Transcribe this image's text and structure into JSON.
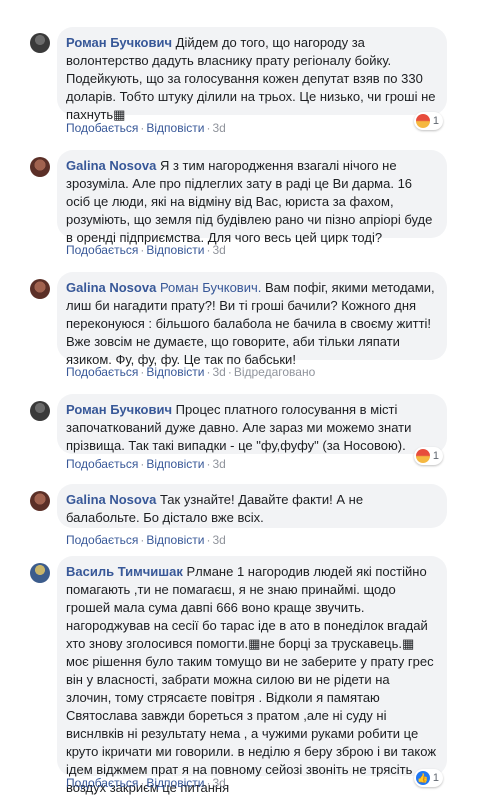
{
  "actions": {
    "like": "Подобається",
    "reply": "Відповісти",
    "time": "3d",
    "edited": "Відредаговано",
    "dot": "·"
  },
  "comments": [
    {
      "author": "Роман Бучкович",
      "text": "Дійдем до того, що нагороду за волонтерство дадуть власнику прату регіоналу бойку. Подейкують, що за голосування кожен депутат взяв по 330 доларів. Тобто штуку ділили на трьох. Це низько, чи гроші не пахнуть▦",
      "reaction": {
        "icon": "angry-icon",
        "count": "1"
      }
    },
    {
      "author": "Galina Nosova",
      "text": "Я з тим нагородження взагалі нічого не зрозуміла. Але про підлеглих зату в раді це Ви дарма. 16 осіб це люди, які на відміну від Вас, юриста за фахом, розуміють, що земля під будівлею рано чи пізно апріорі буде в оренді підприємства. Для чого весь цей цирк тоді?"
    },
    {
      "author": "Galina Nosova",
      "mention": "Роман Бучкович.",
      "text": " Вам пофіг, якими методами, лиш би нагадити прату?! Ви ті гроші бачили? Кожного дня переконуюся : більшого балабола не бачила в своєму житті! Вже зовсім не думаєте, що говорите, аби тільки ляпати язиком. Фу, фу, фу. Це так по бабськи!",
      "edited": true
    },
    {
      "author": "Роман Бучкович",
      "text": "Процес платного голосування в місті започаткований дуже давно. Але зараз ми можемо знати прізвища. Так такі випадки - це \"фу,фуфу\" (за Носовою).",
      "reaction": {
        "icon": "angry-icon",
        "count": "1"
      }
    },
    {
      "author": "Galina Nosova",
      "text": "Так узнайте! Давайте факти! А не балабольте. Бо дістало вже всіх."
    },
    {
      "author": "Василь Тимчишак",
      "text": "Рлмане 1 нагородив людей які постійно помагають ,ти не помагаєш, я не знаю принаймі. щодо грошей мала сума давпі 666 воно краще звучить. нагороджував на сесії бо тарас іде в ато в понеділок вгадай хто знову зголосився помогти.▦не борці за трускавець.▦ моє рішення було таким томущо ви не заберите у прату грес він у власності, забрати можна силою ви не рідети на злочин, тому стрясаєте повітря . Відколи я памятаю Святослава завжди бореться з пратом ,але ні суду ні виснлвків ні результату нема , а чужими руками робити це круто ікричати ми говорили. в неділю я беру зброю і ви також ідем віджмем прат я на повному сейозі звоніть не трясіть воздух закриєм це питання",
      "reaction": {
        "icon": "like-icon",
        "count": "1"
      }
    }
  ]
}
